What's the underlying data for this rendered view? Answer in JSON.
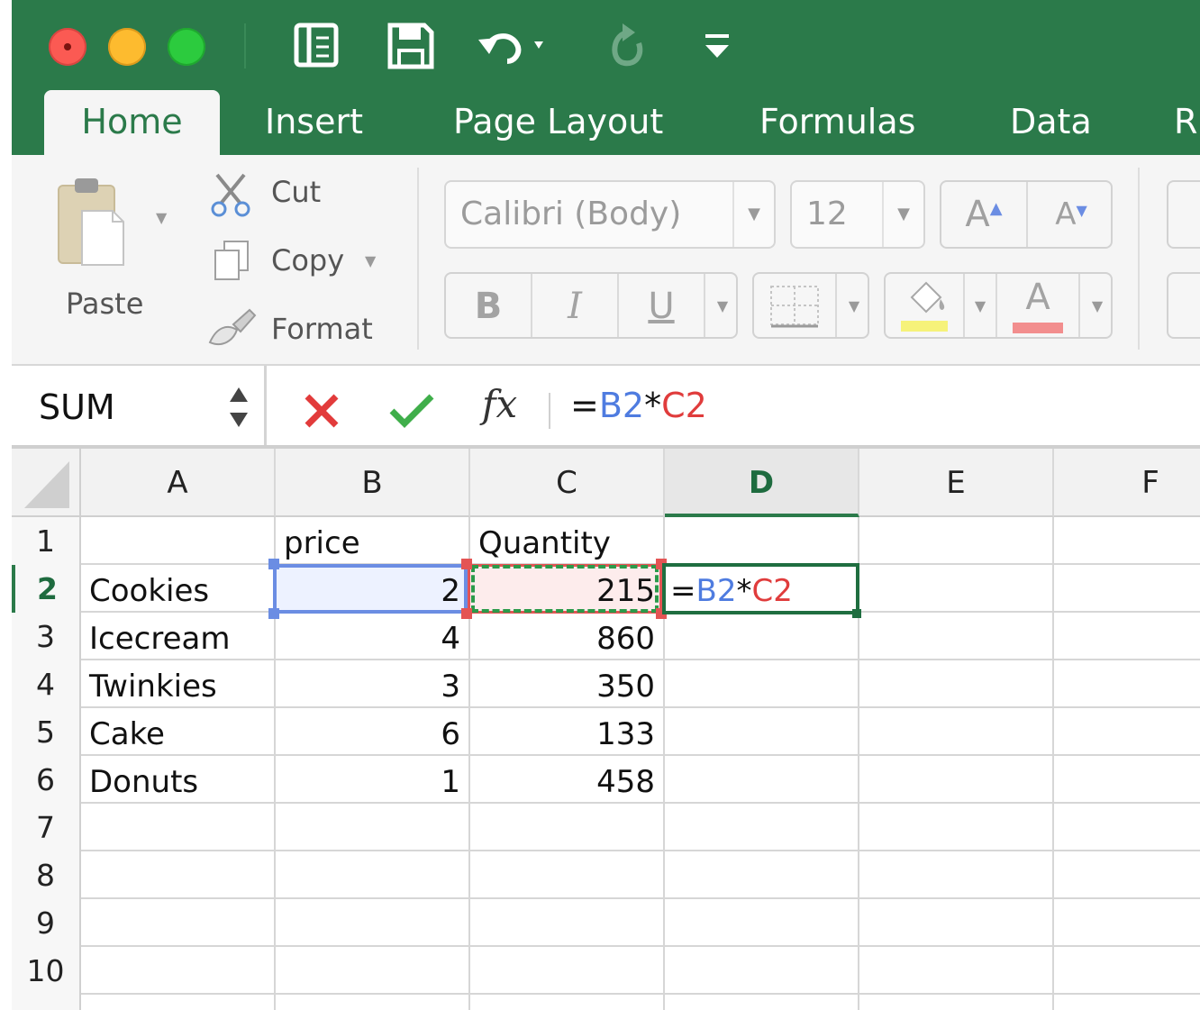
{
  "app": {
    "tabs": [
      {
        "label": "Home",
        "active": true
      },
      {
        "label": "Insert",
        "active": false
      },
      {
        "label": "Page Layout",
        "active": false
      },
      {
        "label": "Formulas",
        "active": false
      },
      {
        "label": "Data",
        "active": false
      },
      {
        "label": "R",
        "active": false
      }
    ]
  },
  "ribbon": {
    "paste_label": "Paste",
    "cut_label": "Cut",
    "copy_label": "Copy",
    "format_label": "Format",
    "font_name": "Calibri (Body)",
    "font_size": "12",
    "bold": "B",
    "italic": "I",
    "underline": "U",
    "grow_font": "A",
    "shrink_font": "A",
    "font_color_glyph": "A"
  },
  "formula_bar": {
    "name_box": "SUM",
    "fx": "fx",
    "formula_prefix": "=",
    "formula_ref1": "B2",
    "formula_op": "*",
    "formula_ref2": "C2"
  },
  "grid": {
    "columns": [
      "A",
      "B",
      "C",
      "D",
      "E",
      "F"
    ],
    "selected_column": "D",
    "rows": [
      "1",
      "2",
      "3",
      "4",
      "5",
      "6",
      "7",
      "8",
      "9",
      "10"
    ],
    "selected_row": "2",
    "header_row": {
      "B": "price",
      "C": "Quantity"
    },
    "data": [
      {
        "item": "Cookies",
        "price": "2",
        "quantity": "215"
      },
      {
        "item": "Icecream",
        "price": "4",
        "quantity": "860"
      },
      {
        "item": "Twinkies",
        "price": "3",
        "quantity": "350"
      },
      {
        "item": "Cake",
        "price": "6",
        "quantity": "133"
      },
      {
        "item": "Donuts",
        "price": "1",
        "quantity": "458"
      }
    ],
    "editing_cell": {
      "prefix": "=",
      "ref1": "B2",
      "op": "*",
      "ref2": "C2"
    }
  },
  "colors": {
    "brand_green": "#2b7a4a",
    "ref1_blue": "#4f7ce0",
    "ref2_red": "#e03c3c",
    "cancel_red": "#e23b3b",
    "confirm_green": "#3fae4a"
  }
}
